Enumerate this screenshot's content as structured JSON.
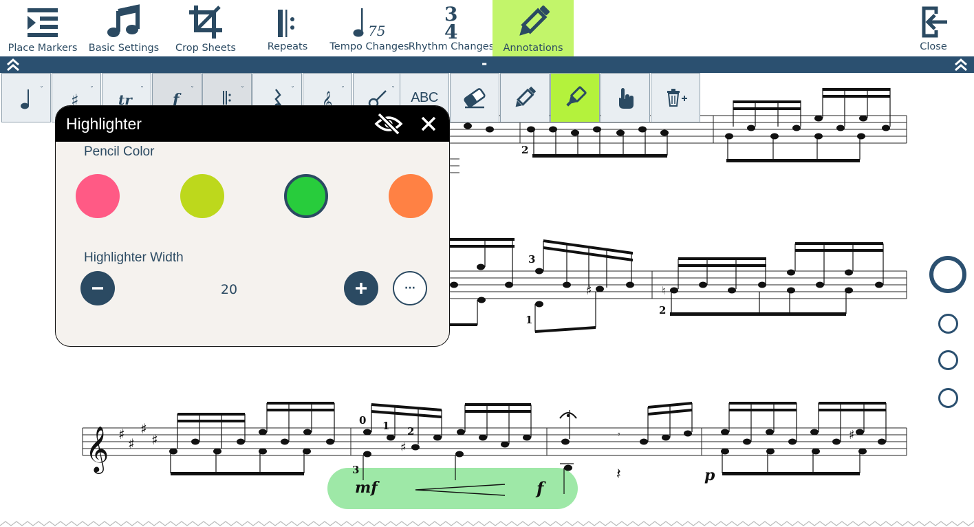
{
  "toolbar": {
    "items": [
      {
        "label": "Place Markers",
        "icon": "place-markers-icon"
      },
      {
        "label": "Basic Settings",
        "icon": "music-note-icon"
      },
      {
        "label": "Crop Sheets",
        "icon": "crop-icon"
      },
      {
        "label": "Repeats",
        "icon": "repeat-sign-icon"
      },
      {
        "label": "Tempo Changes",
        "icon": "tempo-icon",
        "value": "75"
      },
      {
        "label": "Rhythm Changes",
        "icon": "time-signature-icon",
        "top": "3",
        "bottom": "4"
      },
      {
        "label": "Annotations",
        "icon": "pencil-icon",
        "active": true
      },
      {
        "label": "Close",
        "icon": "exit-icon"
      }
    ]
  },
  "subbar": {
    "center_text": "-"
  },
  "tools": {
    "abc_label": "ABC",
    "active_tool": "highlighter"
  },
  "panel": {
    "title": "Highlighter",
    "pencil_color_label": "Pencil Color",
    "colors": [
      "#ff5a85",
      "#bdd81c",
      "#28cc3c",
      "#ff8144"
    ],
    "selected_color": "#28cc3c",
    "width_label": "Highlighter Width",
    "width_value": "20",
    "more_label": "···"
  },
  "score": {
    "fingerings": {
      "f1": "2",
      "f2": "3",
      "f3": "1",
      "f4": "2",
      "f5": "0",
      "f6": "1",
      "f7": "2",
      "f8": "3"
    },
    "dynamics": {
      "d1": "mf",
      "d2": "f",
      "d3": "p"
    },
    "highlight_color": "#28cc3c"
  },
  "colors": {
    "accent": "#2b5070",
    "active_tab": "#c2f56a",
    "active_tool": "#b4f23c",
    "panel_bg": "#f5f2ee"
  }
}
